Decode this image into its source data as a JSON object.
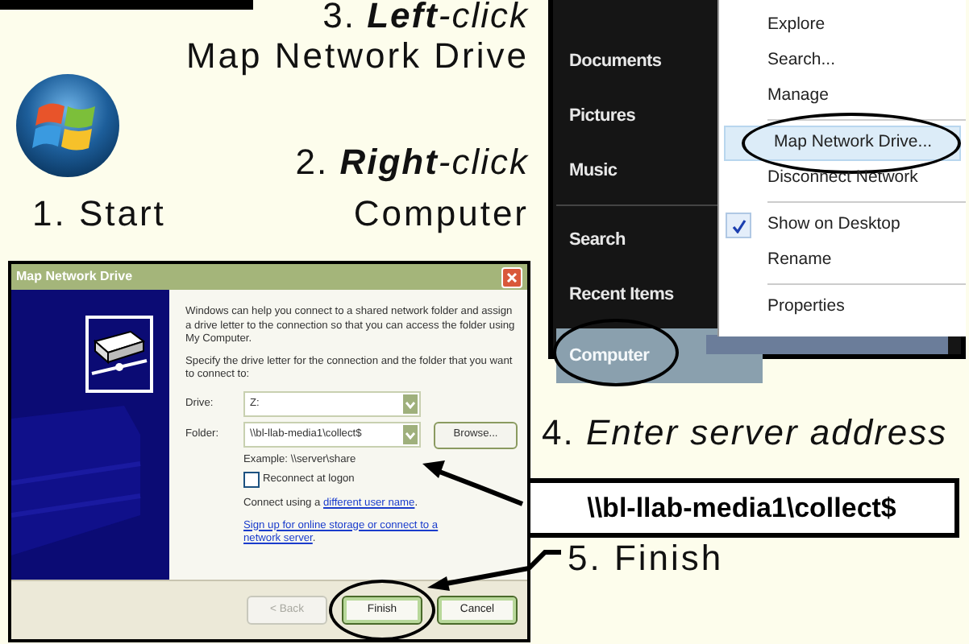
{
  "captions": [
    {
      "kind": "action",
      "number": "3.",
      "action": "**Left**-click"
    },
    {
      "kind": "plain",
      "text": "Map Network Drive"
    },
    {
      "kind": "action",
      "number": "2.",
      "action": "**Right**-click"
    },
    {
      "kind": "plain",
      "text": "1. Start"
    },
    {
      "kind": "plain",
      "text": "Computer"
    },
    {
      "kind": "action",
      "number": "4.",
      "action": "Enter server address"
    },
    {
      "kind": "callout",
      "text": "\\\\bl-llab-media1\\collect$"
    },
    {
      "kind": "plain",
      "text": "5. Finish"
    }
  ],
  "start_menu": {
    "groups": [
      [
        {
          "label": "Documents",
          "selected": false,
          "circled": false
        },
        {
          "label": "Pictures",
          "selected": false,
          "circled": false
        },
        {
          "label": "Music",
          "selected": false,
          "circled": false
        }
      ],
      [
        {
          "label": "Search",
          "selected": false,
          "circled": false
        },
        {
          "label": "Recent Items",
          "selected": false,
          "circled": false
        },
        {
          "label": "Computer",
          "selected": true,
          "circled": true
        }
      ]
    ]
  },
  "context_menu": {
    "groups": [
      [
        {
          "label": "Explore",
          "selected": false,
          "checked": false,
          "circled": false
        },
        {
          "label": "Search...",
          "selected": false,
          "checked": false,
          "circled": false
        },
        {
          "label": "Manage",
          "selected": false,
          "checked": false,
          "circled": false
        }
      ],
      [
        {
          "label": "Map Network Drive...",
          "selected": true,
          "checked": false,
          "circled": true
        },
        {
          "label": "Disconnect Network",
          "selected": false,
          "checked": false,
          "circled": false
        }
      ],
      [
        {
          "label": "Show on Desktop",
          "selected": false,
          "checked": true,
          "circled": false
        },
        {
          "label": "Rename",
          "selected": false,
          "checked": false,
          "circled": false
        }
      ],
      [
        {
          "label": "Properties",
          "selected": false,
          "checked": false,
          "circled": false
        }
      ]
    ]
  },
  "dialog": {
    "title": "Map Network Drive",
    "intro": "Windows can help you connect to a shared network folder and assign a drive letter to the connection so that you can access the folder using My Computer.",
    "instruction": "Specify the drive letter for the connection and the folder that you want to connect to:",
    "drive": {
      "label": "Drive:",
      "value": "Z:"
    },
    "folder": {
      "label": "Folder:",
      "value": "\\\\bl-llab-media1\\collect$"
    },
    "browse": "Browse...",
    "example": "Example: \\\\server\\share",
    "reconnect": {
      "label": "Reconnect at logon",
      "checked": false
    },
    "connect": {
      "prefix": "Connect using a ",
      "link": "different user name",
      "suffix": "."
    },
    "signup": {
      "link": "Sign up for online storage or connect to a network server",
      "suffix": "."
    },
    "buttons": [
      {
        "label": "< Back",
        "disabled": true,
        "circled": false
      },
      {
        "label": "Finish",
        "disabled": false,
        "circled": true
      },
      {
        "label": "Cancel",
        "disabled": false,
        "circled": false
      }
    ]
  }
}
